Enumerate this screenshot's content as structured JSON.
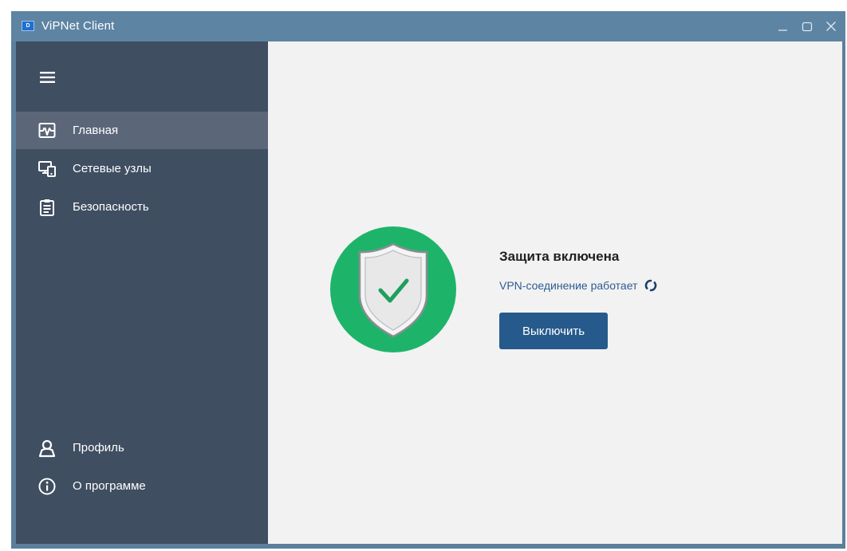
{
  "window": {
    "title": "ViPNet Client",
    "app_icon_text": "D"
  },
  "sidebar": {
    "menu_icon": "hamburger-icon",
    "items": [
      {
        "label": "Главная",
        "icon": "dashboard-pulse-icon",
        "active": true
      },
      {
        "label": "Сетевые узлы",
        "icon": "network-nodes-icon",
        "active": false
      },
      {
        "label": "Безопасность",
        "icon": "clipboard-security-icon",
        "active": false
      }
    ],
    "bottom_items": [
      {
        "label": "Профиль",
        "icon": "user-icon"
      },
      {
        "label": "О программе",
        "icon": "info-icon"
      }
    ]
  },
  "main": {
    "status_title": "Защита включена",
    "vpn_status": "VPN-соединение работает",
    "disable_button": "Выключить"
  },
  "colors": {
    "titlebar": "#5d84a3",
    "sidebar": "#3f4e61",
    "sidebar_active": "#5b6778",
    "content_bg": "#f2f2f2",
    "shield_green": "#1db46a",
    "button_blue": "#265a8c",
    "link_blue": "#2d5b92"
  }
}
